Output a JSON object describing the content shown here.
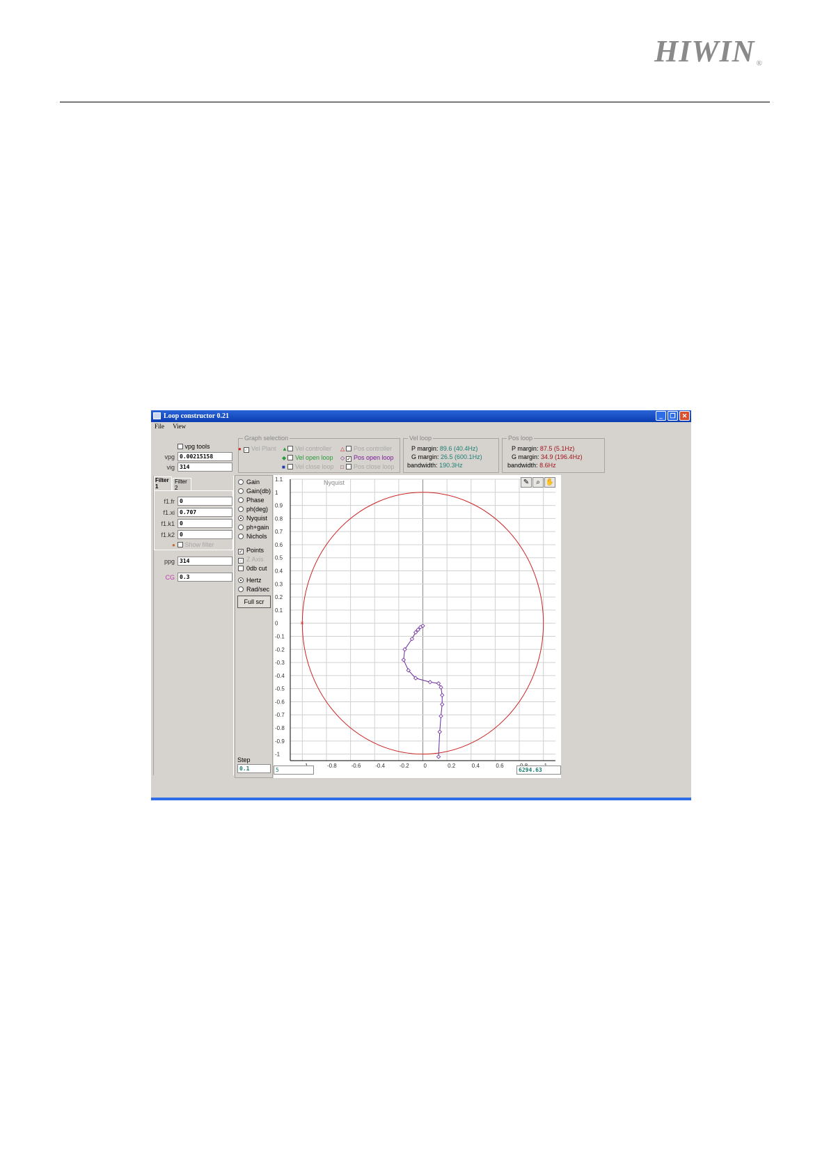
{
  "brand": {
    "logo_text": "HIWIN",
    "registered": "®"
  },
  "window": {
    "title": "Loop constructor 0.21",
    "menu": [
      "File",
      "View"
    ]
  },
  "gains": {
    "vpg_tools_label": "vpg tools",
    "vpg_label": "vpg",
    "vpg_value": "0.00215158",
    "vig_label": "vig",
    "vig_value": "314",
    "filter_tab1": "Filter 1",
    "filter_tab2": "Filter 2",
    "f1fr_label": "f1.fr",
    "f1fr_value": "0",
    "f1xi_label": "f1.xi",
    "f1xi_value": "0.707",
    "f1k1_label": "f1.k1",
    "f1k1_value": "0",
    "f1k2_label": "f1.k2",
    "f1k2_value": "0",
    "show_filter_label": "Show filter",
    "ppg_label": "ppg",
    "ppg_value": "314",
    "cg_label": "CG",
    "cg_value": "0.3"
  },
  "graph_selection": {
    "title": "Graph selection",
    "items": [
      {
        "label": "Vel Plant",
        "checked": true,
        "enabled": false,
        "marker": "●",
        "color": "#cc2222"
      },
      {
        "label": "Vel controller",
        "checked": false,
        "enabled": false,
        "marker": "▲",
        "color": "#2a9a3a"
      },
      {
        "label": "Pos controller",
        "checked": false,
        "enabled": false,
        "marker": "△",
        "color": "#cc2222"
      },
      {
        "label": "Vel open loop",
        "checked": false,
        "enabled": true,
        "marker": "◆",
        "color": "#2a9a3a"
      },
      {
        "label": "Pos open loop",
        "checked": true,
        "enabled": true,
        "marker": "◇",
        "color": "#7a1a9a"
      },
      {
        "label": "Vel close loop",
        "checked": false,
        "enabled": false,
        "marker": "■",
        "color": "#1a3ab0"
      },
      {
        "label": "Pos close loop",
        "checked": false,
        "enabled": false,
        "marker": "□",
        "color": "#7a1a1a"
      }
    ]
  },
  "vel_loop": {
    "title": "Vel loop",
    "p_margin_label": "P margin:",
    "p_margin_value": "89.6 (40.4Hz)",
    "g_margin_label": "G margin:",
    "g_margin_value": "26.5 (600.1Hz)",
    "bandwidth_label": "bandwidth:",
    "bandwidth_value": "190.3Hz"
  },
  "pos_loop": {
    "title": "Pos loop",
    "p_margin_label": "P margin:",
    "p_margin_value": "87.5 (5.1Hz)",
    "g_margin_label": "G margin:",
    "g_margin_value": "34.9 (196.4Hz)",
    "bandwidth_label": "bandwidth:",
    "bandwidth_value": "8.6Hz"
  },
  "plot_options": {
    "types": [
      {
        "label": "Gain",
        "selected": false
      },
      {
        "label": "Gain(db)",
        "selected": false
      },
      {
        "label": "Phase",
        "selected": false
      },
      {
        "label": "ph(deg)",
        "selected": false
      },
      {
        "label": "Nyquist",
        "selected": true
      },
      {
        "label": "ph+gain",
        "selected": false
      },
      {
        "label": "Nichols",
        "selected": false
      }
    ],
    "points_label": "Points",
    "points_checked": true,
    "zaxis_label": "Z Axis",
    "zaxis_checked": true,
    "odb_label": "0db cut",
    "odb_checked": false,
    "hertz_label": "Hertz",
    "hertz_selected": true,
    "radsec_label": "Rad/sec",
    "radsec_selected": false,
    "fullscr_label": "Full scr",
    "step_label": "Step",
    "step_value": "0.1"
  },
  "plot_footer": {
    "freq_min": "5",
    "freq_max": "6294.63"
  },
  "tools": {
    "icons": [
      "pencil-icon",
      "zoom-icon",
      "hand-icon"
    ]
  },
  "chart_data": {
    "type": "line",
    "title": "Nyquist",
    "xlim": [
      -1.1,
      1.1
    ],
    "ylim": [
      -1.05,
      1.1
    ],
    "x_ticks": [
      "-1",
      "-0.8",
      "-0.6",
      "-0.4",
      "-0.2",
      "0",
      "0.2",
      "0.4",
      "0.6",
      "0.8",
      "1"
    ],
    "y_ticks": [
      "1.1",
      "1",
      "0.9",
      "0.8",
      "0.7",
      "0.6",
      "0.5",
      "0.4",
      "0.3",
      "0.2",
      "0.1",
      "0",
      "-0.1",
      "-0.2",
      "-0.3",
      "-0.4",
      "-0.5",
      "-0.6",
      "-0.7",
      "-0.8",
      "-0.9",
      "-1"
    ],
    "grid": true,
    "unit_circle": {
      "radius": 1,
      "color": "#cc2222"
    },
    "critical_point": {
      "x": -1,
      "y": 0,
      "marker": "×"
    },
    "series": [
      {
        "color": "#6a2a9a",
        "points": [
          [
            0.0,
            -0.02
          ],
          [
            -0.02,
            -0.03
          ],
          [
            -0.04,
            -0.05
          ],
          [
            -0.06,
            -0.07
          ],
          [
            -0.09,
            -0.12
          ],
          [
            -0.15,
            -0.2
          ],
          [
            -0.16,
            -0.28
          ],
          [
            -0.12,
            -0.36
          ],
          [
            -0.06,
            -0.42
          ],
          [
            0.06,
            -0.45
          ],
          [
            0.13,
            -0.46
          ],
          [
            0.15,
            -0.49
          ],
          [
            0.16,
            -0.55
          ],
          [
            0.16,
            -0.62
          ],
          [
            0.15,
            -0.71
          ],
          [
            0.14,
            -0.83
          ],
          [
            0.13,
            -1.02
          ]
        ]
      }
    ]
  },
  "colors": {
    "window_bg": "#d6d3ce",
    "title_blue": "#0a3cb0",
    "circle_red": "#cc2222",
    "curve_purple": "#6a2a9a"
  }
}
